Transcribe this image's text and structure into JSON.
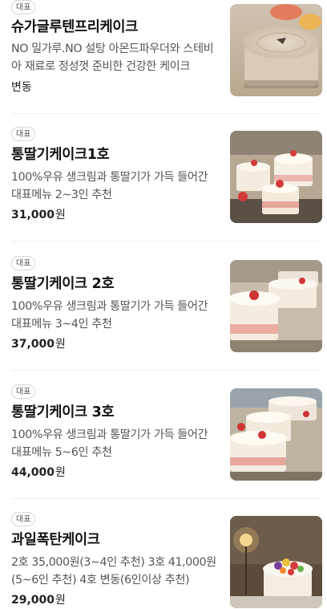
{
  "menu": {
    "items": [
      {
        "badge": "대표",
        "name": "슈가글루텐프리케이크",
        "description": "NO 밀가루.NO 설탕 아몬드파우더와 스테비아 재료로 정성껏 준비한 건강한 케이크",
        "price_amount": "변동",
        "price_unit": "",
        "image_icon": "cake-photo-icon"
      },
      {
        "badge": "대표",
        "name": "통딸기케이크1호",
        "description": "100%우유 생크림과 통딸기가 가득 들어간 대표메뉴 2~3인 추천",
        "price_amount": "31,000",
        "price_unit": "원",
        "image_icon": "cake-photo-icon"
      },
      {
        "badge": "대표",
        "name": "통딸기케이크 2호",
        "description": "100%우유 생크림과 통딸기가 가득 들어간 대표메뉴 3~4인 추천",
        "price_amount": "37,000",
        "price_unit": "원",
        "image_icon": "cake-photo-icon"
      },
      {
        "badge": "대표",
        "name": "통딸기케이크 3호",
        "description": "100%우유 생크림과 통딸기가 가득 들어간 대표메뉴 5~6인 추천",
        "price_amount": "44,000",
        "price_unit": "원",
        "image_icon": "cake-photo-icon"
      },
      {
        "badge": "대표",
        "name": "과일폭탄케이크",
        "description": "2호 35,000원(3~4인 추천) 3호 41,000원(5~6인 추천) 4호 변동(6인이상 추천)",
        "price_amount": "29,000",
        "price_unit": "원",
        "image_icon": "cake-photo-icon"
      }
    ]
  },
  "colors": {
    "text_primary": "#111111",
    "text_secondary": "#555555",
    "divider": "#efefef",
    "badge_border": "#d6d6d6"
  }
}
